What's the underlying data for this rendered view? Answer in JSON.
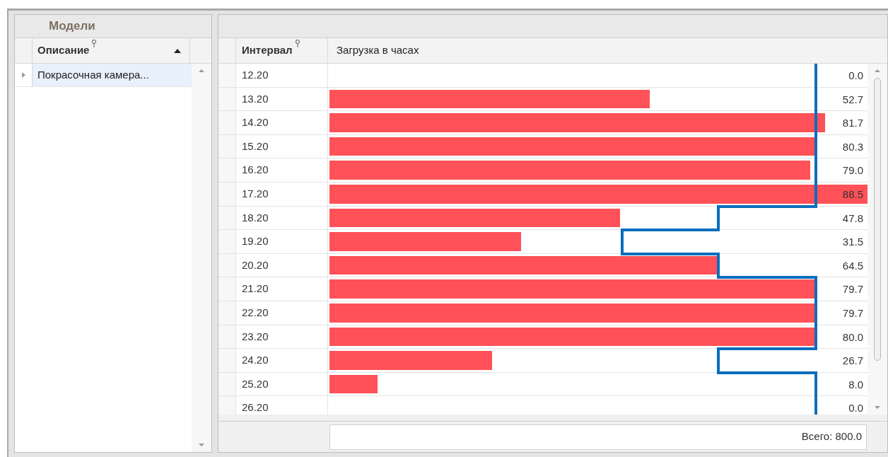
{
  "models_panel": {
    "title": "Модели",
    "columns": [
      {
        "label": "Описание",
        "sorted": true
      }
    ],
    "rows": [
      {
        "description": "Покрасочная камера...",
        "selected": true
      }
    ]
  },
  "load_panel": {
    "columns": [
      {
        "label": "Интервал",
        "filter": true
      },
      {
        "label": "Загрузка в часах",
        "filter": false
      }
    ],
    "rows": [
      {
        "interval": "12.20",
        "value": "0.0",
        "bar": {
          "level": 0
        },
        "limit": {
          "level": 0.904
        }
      },
      {
        "interval": "13.20",
        "value": "52.7",
        "bar": {
          "level": 0.595
        },
        "limit": {
          "level": 0.904
        }
      },
      {
        "interval": "14.20",
        "value": "81.7",
        "bar": {
          "level": 0.921
        },
        "limit": {
          "level": 0.904
        }
      },
      {
        "interval": "15.20",
        "value": "80.3",
        "bar": {
          "level": 0.907
        },
        "limit": {
          "level": 0.904
        }
      },
      {
        "interval": "16.20",
        "value": "79.0",
        "bar": {
          "level": 0.893
        },
        "limit": {
          "level": 0.904
        }
      },
      {
        "interval": "17.20",
        "value": "88.5",
        "bar": {
          "level": 1
        },
        "limit": {
          "level": 0.904
        }
      },
      {
        "interval": "18.20",
        "value": "47.8",
        "bar": {
          "level": 0.54
        },
        "limit": {
          "level": 0.724
        }
      },
      {
        "interval": "19.20",
        "value": "31.5",
        "bar": {
          "level": 0.356
        },
        "limit": {
          "level": 0.545
        }
      },
      {
        "interval": "20.20",
        "value": "64.5",
        "bar": {
          "level": 0.724
        },
        "limit": {
          "level": 0.724
        }
      },
      {
        "interval": "21.20",
        "value": "79.7",
        "bar": {
          "level": 0.901
        },
        "limit": {
          "level": 0.904
        }
      },
      {
        "interval": "22.20",
        "value": "79.7",
        "bar": {
          "level": 0.901
        },
        "limit": {
          "level": 0.904
        }
      },
      {
        "interval": "23.20",
        "value": "80.0",
        "bar": {
          "level": 0.904
        },
        "limit": {
          "level": 0.904
        }
      },
      {
        "interval": "24.20",
        "value": "26.7",
        "bar": {
          "level": 0.302
        },
        "limit": {
          "level": 0.724
        }
      },
      {
        "interval": "25.20",
        "value": "8.0",
        "bar": {
          "level": 0.09
        },
        "limit": {
          "level": 0.904
        }
      },
      {
        "interval": "26.20",
        "value": "0.0",
        "bar": {
          "level": 0
        },
        "limit": {
          "level": 0.904
        }
      }
    ],
    "total": "Всего: 800.0"
  }
}
